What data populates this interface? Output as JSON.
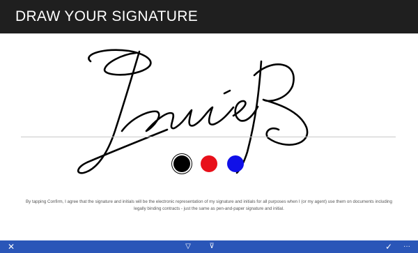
{
  "header": {
    "title": "DRAW YOUR SIGNATURE"
  },
  "signature": {
    "ink_color": "#000000"
  },
  "colors": {
    "header_bg": "#1f1f1f",
    "appbar_bg": "#2a56b8",
    "swatches": [
      "#000000",
      "#e8101a",
      "#1010e8"
    ]
  },
  "swatch_labels": [
    "black",
    "red",
    "blue"
  ],
  "consent_text": "By tapping Confirm, I agree that the signature and initials will be the electronic representation of my signature and initials for all purposes when I (or my agent) use them on documents including legally binding contracts - just the same as pen-and-paper signature and initial.",
  "appbar": {
    "icons": [
      "close-icon",
      "filter-icon",
      "filter-clear-icon",
      "checkmark-icon",
      "more-icon"
    ]
  }
}
